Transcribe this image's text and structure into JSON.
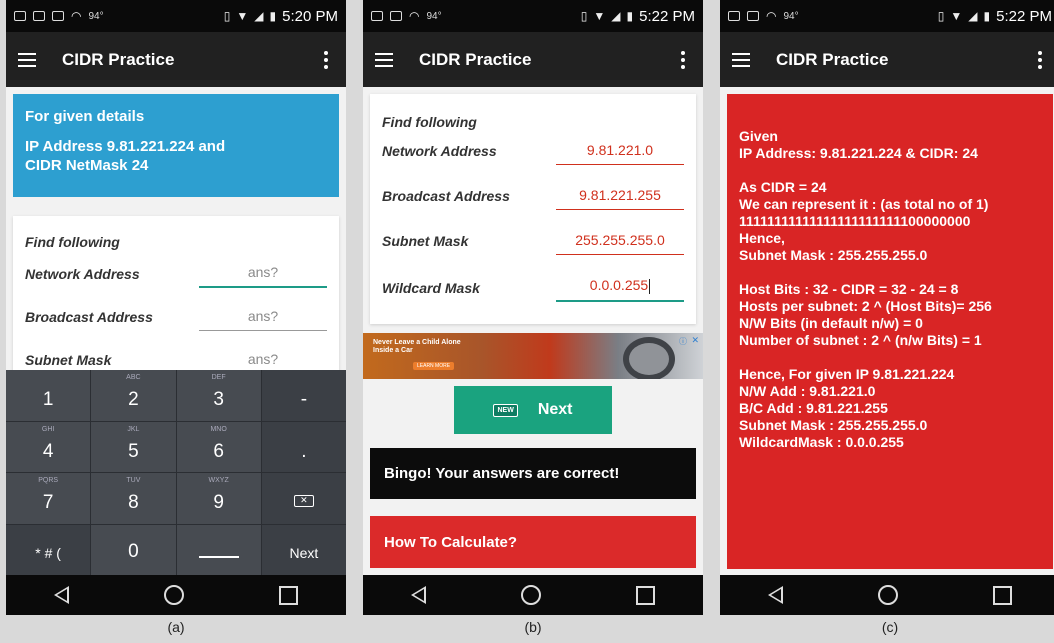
{
  "status": {
    "temp": "94°"
  },
  "screens": [
    {
      "time": "5:20 PM"
    },
    {
      "time": "5:22 PM"
    },
    {
      "time": "5:22 PM"
    }
  ],
  "appbar": {
    "title": "CIDR Practice"
  },
  "given_card": {
    "line1": "For given details",
    "line2": "IP Address 9.81.221.224 and",
    "line3": "CIDR NetMask 24"
  },
  "form": {
    "heading": "Find following",
    "labels": {
      "network": "Network Address",
      "broadcast": "Broadcast Address",
      "subnet": "Subnet Mask",
      "wildcard": "Wildcard Mask"
    },
    "placeholder": "ans?",
    "answers": {
      "network": "9.81.221.0",
      "broadcast": "9.81.221.255",
      "subnet": "255.255.255.0",
      "wildcard": "0.0.0.255"
    }
  },
  "keyboard": {
    "keys": [
      {
        "num": "1",
        "sub": ""
      },
      {
        "num": "2",
        "sub": "ABC"
      },
      {
        "num": "3",
        "sub": "DEF"
      },
      {
        "num": "-",
        "sub": ""
      },
      {
        "num": "4",
        "sub": "GHI"
      },
      {
        "num": "5",
        "sub": "JKL"
      },
      {
        "num": "6",
        "sub": "MNO"
      },
      {
        "num": ".",
        "sub": ""
      },
      {
        "num": "7",
        "sub": "PQRS"
      },
      {
        "num": "8",
        "sub": "TUV"
      },
      {
        "num": "9",
        "sub": "WXYZ"
      },
      {
        "num": "0",
        "sub": ""
      },
      {
        "num": "* # (",
        "sub": ""
      }
    ],
    "next_label": "Next",
    "delete_glyph": "⌫"
  },
  "ad": {
    "text": "Never Leave a Child Alone Inside a Car",
    "button": "LEARN MORE"
  },
  "next_button": {
    "label": "Next",
    "badge": "NEW"
  },
  "result": {
    "text": "Bingo! Your answers are correct!"
  },
  "howto": {
    "label": "How To Calculate?"
  },
  "explanation": {
    "lines": [
      "Given",
      "IP Address: 9.81.221.224 & CIDR: 24",
      "As CIDR = 24",
      "We can represent it : (as total no of 1)",
      "11111111111111111111111100000000",
      "Hence,",
      "Subnet Mask : 255.255.255.0",
      "Host Bits : 32 - CIDR = 32 - 24 = 8",
      "Hosts per subnet: 2 ^ (Host Bits)= 256",
      "N/W Bits (in default n/w) = 0",
      "Number of subnet : 2 ^ (n/w Bits) = 1",
      "Hence, For given IP 9.81.221.224",
      "N/W Add : 9.81.221.0",
      "B/C Add : 9.81.221.255",
      "Subnet Mask : 255.255.255.0",
      "WildcardMask : 0.0.0.255"
    ]
  },
  "captions": [
    "(a)",
    "(b)",
    "(c)"
  ],
  "colors": {
    "blue_card": "#2d9fd0",
    "teal": "#1aa37f",
    "red": "#db2a2a",
    "answer_red": "#d0301d"
  }
}
